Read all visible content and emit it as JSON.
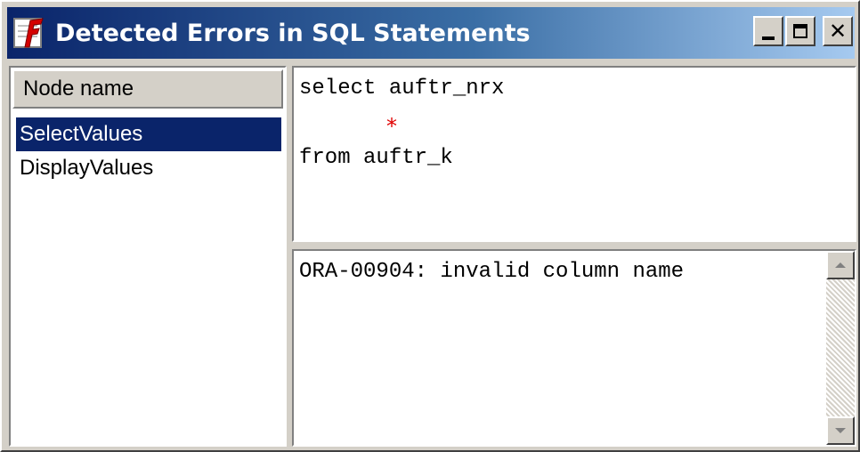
{
  "window": {
    "title": "Detected Errors in SQL Statements",
    "icon": "oracle-forms-app-icon",
    "buttons": {
      "minimize": "minimize-icon",
      "maximize": "maximize-icon",
      "close": "close-icon"
    },
    "colors": {
      "titlebar_start": "#0a246a",
      "titlebar_end": "#a6caf0",
      "selection": "#0a246a",
      "error_marker": "#e00000"
    }
  },
  "nodes": {
    "header": "Node name",
    "items": [
      {
        "label": "SelectValues",
        "selected": true
      },
      {
        "label": "DisplayValues",
        "selected": false
      }
    ]
  },
  "sql": {
    "lines": [
      "select auftr_nrx",
      "from auftr_k"
    ],
    "error_marker": "*"
  },
  "message": {
    "text": "ORA-00904: invalid column name"
  }
}
